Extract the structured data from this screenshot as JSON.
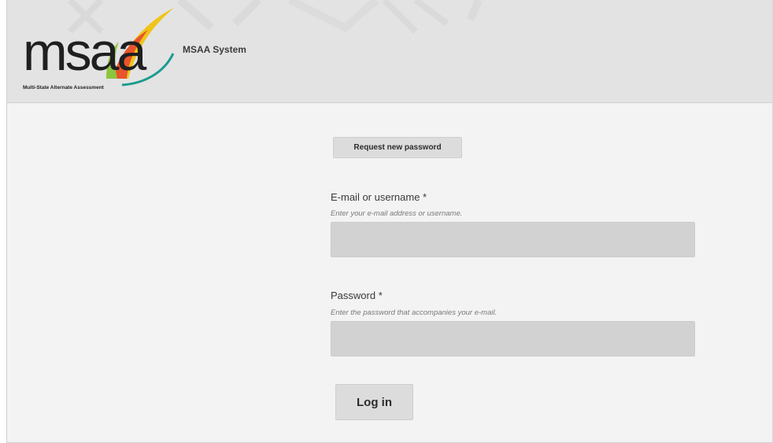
{
  "header": {
    "logo_text": "msaa",
    "logo_tagline": "Multi-State Alternate Assessment",
    "site_name": "MSAA System",
    "logo_colors": [
      "#f0c419",
      "#e8542b",
      "#1a9b8f",
      "#8cc63f"
    ]
  },
  "tabs": {
    "request_password": "Request new password"
  },
  "form": {
    "username": {
      "label": "E-mail or username *",
      "description": "Enter your e-mail address or username.",
      "value": ""
    },
    "password": {
      "label": "Password *",
      "description": "Enter the password that accompanies your e-mail.",
      "value": ""
    },
    "submit_label": "Log in"
  }
}
